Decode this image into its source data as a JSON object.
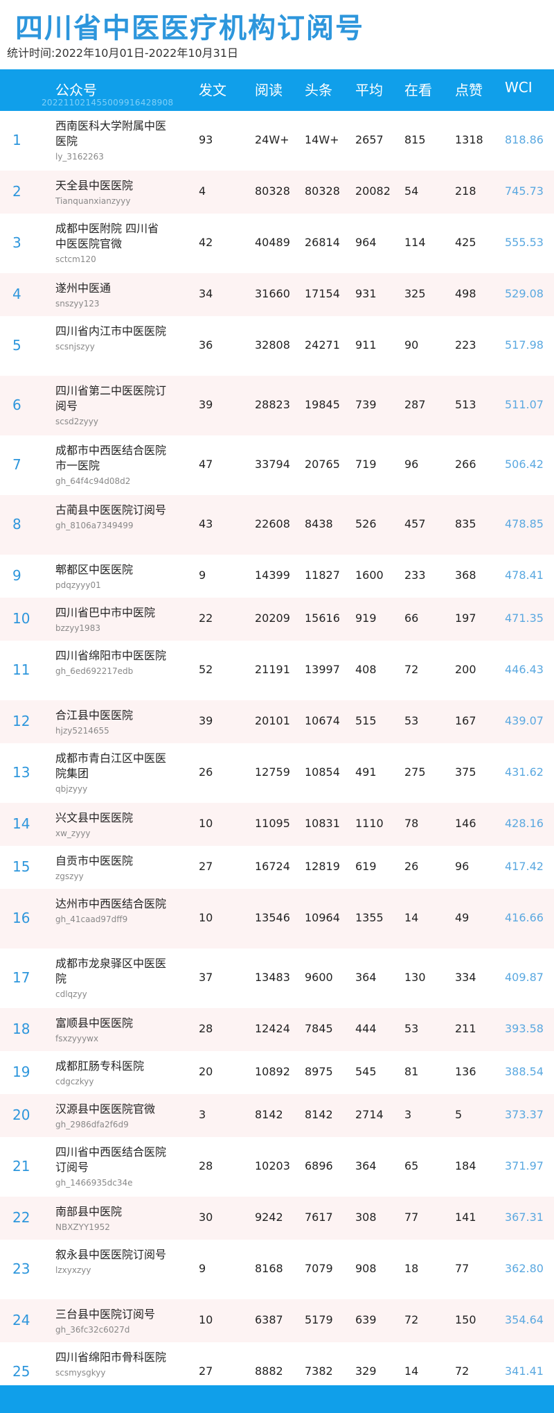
{
  "page": {
    "title": "四川省中医医疗机构订阅号",
    "period": "统计时间:2022年10月01日-2022年10月31日"
  },
  "table": {
    "headers": {
      "account": "公众号",
      "posts": "发文",
      "reads": "阅读",
      "headline": "头条",
      "avg": "平均",
      "watching": "在看",
      "likes": "点赞",
      "wci": "WCI"
    },
    "header_id": "20221102145500991642890​8",
    "rows": [
      {
        "rank": "1",
        "name": "西南医科大学附属中医医院",
        "acct": "ly_3162263",
        "posts": "93",
        "reads": "24W+",
        "headline": "14W+",
        "avg": "2657",
        "watching": "815",
        "likes": "1318",
        "wci": "818.86"
      },
      {
        "rank": "2",
        "name": "天全县中医医院",
        "acct": "Tianquanxianzyyy",
        "posts": "4",
        "reads": "80328",
        "headline": "80328",
        "avg": "20082",
        "watching": "54",
        "likes": "218",
        "wci": "745.73"
      },
      {
        "rank": "3",
        "name": "成都中医附院 四川省中医医院官微",
        "acct": "sctcm120",
        "posts": "42",
        "reads": "40489",
        "headline": "26814",
        "avg": "964",
        "watching": "114",
        "likes": "425",
        "wci": "555.53"
      },
      {
        "rank": "4",
        "name": "遂州中医通",
        "acct": "snszyy123",
        "posts": "34",
        "reads": "31660",
        "headline": "17154",
        "avg": "931",
        "watching": "325",
        "likes": "498",
        "wci": "529.08"
      },
      {
        "rank": "5",
        "name": "四川省内江市中医医院",
        "acct": "scsnjszyy",
        "posts": "36",
        "reads": "32808",
        "headline": "24271",
        "avg": "911",
        "watching": "90",
        "likes": "223",
        "wci": "517.98"
      },
      {
        "rank": "6",
        "name": "四川省第二中医医院订阅号",
        "acct": "scsd2zyyy",
        "posts": "39",
        "reads": "28823",
        "headline": "19845",
        "avg": "739",
        "watching": "287",
        "likes": "513",
        "wci": "511.07"
      },
      {
        "rank": "7",
        "name": "成都市中西医结合医院 市一医院",
        "acct": "gh_64f4c94d08d2",
        "posts": "47",
        "reads": "33794",
        "headline": "20765",
        "avg": "719",
        "watching": "96",
        "likes": "266",
        "wci": "506.42"
      },
      {
        "rank": "8",
        "name": "古蔺县中医医院订阅号",
        "acct": "gh_8106a7349499",
        "posts": "43",
        "reads": "22608",
        "headline": "8438",
        "avg": "526",
        "watching": "457",
        "likes": "835",
        "wci": "478.85"
      },
      {
        "rank": "9",
        "name": "郫都区中医医院",
        "acct": "pdqzyyy01",
        "posts": "9",
        "reads": "14399",
        "headline": "11827",
        "avg": "1600",
        "watching": "233",
        "likes": "368",
        "wci": "478.41"
      },
      {
        "rank": "10",
        "name": "四川省巴中市中医院",
        "acct": "bzzyy1983",
        "posts": "22",
        "reads": "20209",
        "headline": "15616",
        "avg": "919",
        "watching": "66",
        "likes": "197",
        "wci": "471.35"
      },
      {
        "rank": "11",
        "name": "四川省绵阳市中医医院",
        "acct": "gh_6ed692217edb",
        "posts": "52",
        "reads": "21191",
        "headline": "13997",
        "avg": "408",
        "watching": "72",
        "likes": "200",
        "wci": "446.43"
      },
      {
        "rank": "12",
        "name": "合江县中医医院",
        "acct": "hjzy5214655",
        "posts": "39",
        "reads": "20101",
        "headline": "10674",
        "avg": "515",
        "watching": "53",
        "likes": "167",
        "wci": "439.07"
      },
      {
        "rank": "13",
        "name": "成都市青白江区中医医院集团",
        "acct": "qbjzyyy",
        "posts": "26",
        "reads": "12759",
        "headline": "10854",
        "avg": "491",
        "watching": "275",
        "likes": "375",
        "wci": "431.62"
      },
      {
        "rank": "14",
        "name": "兴文县中医医院",
        "acct": "xw_zyyy",
        "posts": "10",
        "reads": "11095",
        "headline": "10831",
        "avg": "1110",
        "watching": "78",
        "likes": "146",
        "wci": "428.16"
      },
      {
        "rank": "15",
        "name": "自贡市中医医院",
        "acct": "zgszyy",
        "posts": "27",
        "reads": "16724",
        "headline": "12819",
        "avg": "619",
        "watching": "26",
        "likes": "96",
        "wci": "417.42"
      },
      {
        "rank": "16",
        "name": "达州市中西医结合医院",
        "acct": "gh_41caad97dff9",
        "posts": "10",
        "reads": "13546",
        "headline": "10964",
        "avg": "1355",
        "watching": "14",
        "likes": "49",
        "wci": "416.66"
      },
      {
        "rank": "17",
        "name": "成都市龙泉驿区中医医院",
        "acct": "cdlqzyy",
        "posts": "37",
        "reads": "13483",
        "headline": "9600",
        "avg": "364",
        "watching": "130",
        "likes": "334",
        "wci": "409.87"
      },
      {
        "rank": "18",
        "name": "富顺县中医医院",
        "acct": "fsxzyyywx",
        "posts": "28",
        "reads": "12424",
        "headline": "7845",
        "avg": "444",
        "watching": "53",
        "likes": "211",
        "wci": "393.58"
      },
      {
        "rank": "19",
        "name": "成都肛肠专科医院",
        "acct": "cdgczkyy",
        "posts": "20",
        "reads": "10892",
        "headline": "8975",
        "avg": "545",
        "watching": "81",
        "likes": "136",
        "wci": "388.54"
      },
      {
        "rank": "20",
        "name": "汉源县中医医院官微",
        "acct": "gh_2986dfa2f6d9",
        "posts": "3",
        "reads": "8142",
        "headline": "8142",
        "avg": "2714",
        "watching": "3",
        "likes": "5",
        "wci": "373.37"
      },
      {
        "rank": "21",
        "name": "四川省中西医结合医院订阅号",
        "acct": "gh_1466935dc34e",
        "posts": "28",
        "reads": "10203",
        "headline": "6896",
        "avg": "364",
        "watching": "65",
        "likes": "184",
        "wci": "371.97"
      },
      {
        "rank": "22",
        "name": "南部县中医院",
        "acct": "NBXZYY1952",
        "posts": "30",
        "reads": "9242",
        "headline": "7617",
        "avg": "308",
        "watching": "77",
        "likes": "141",
        "wci": "367.31"
      },
      {
        "rank": "23",
        "name": "叙永县中医医院订阅号",
        "acct": "lzxyxzyy",
        "posts": "9",
        "reads": "8168",
        "headline": "7079",
        "avg": "908",
        "watching": "18",
        "likes": "77",
        "wci": "362.80"
      },
      {
        "rank": "24",
        "name": "三台县中医院订阅号",
        "acct": "gh_36fc32c6027d",
        "posts": "10",
        "reads": "6387",
        "headline": "5179",
        "avg": "639",
        "watching": "72",
        "likes": "150",
        "wci": "354.64"
      },
      {
        "rank": "25",
        "name": "四川省绵阳市骨科医院",
        "acct": "scsmysgkyy",
        "posts": "27",
        "reads": "8882",
        "headline": "7382",
        "avg": "329",
        "watching": "14",
        "likes": "72",
        "wci": "341.41"
      }
    ]
  },
  "colors": {
    "accent": "#109fea",
    "title": "#2d96dc",
    "alt_row": "#fdf3f3",
    "wci": "#5aa8e0"
  }
}
